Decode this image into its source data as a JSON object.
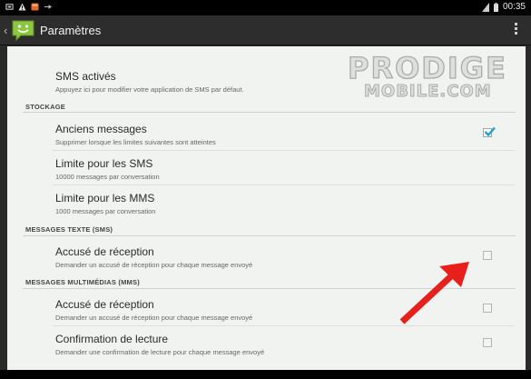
{
  "status_bar": {
    "time": "00:35",
    "icons": [
      "screenshot-icon",
      "warning-icon",
      "app-notification-icon",
      "usb-icon",
      "signal-icon",
      "battery-icon"
    ]
  },
  "action_bar": {
    "title": "Paramètres",
    "app_icon": "messaging-app-icon",
    "overflow_icon": "overflow-menu-icon"
  },
  "watermark": {
    "line1": "PRODIGE",
    "line2": "MOBILE.COM"
  },
  "settings": {
    "sms_enabled": {
      "title": "SMS activés",
      "summary": "Appuyez ici pour modifier votre application de SMS par défaut."
    },
    "storage": {
      "header": "STOCKAGE",
      "old_messages": {
        "title": "Anciens messages",
        "summary": "Supprimer lorsque les limites suivantes sont atteintes",
        "checked": true
      },
      "sms_limit": {
        "title": "Limite pour les SMS",
        "summary": "10000 messages par conversation"
      },
      "mms_limit": {
        "title": "Limite pour les MMS",
        "summary": "1000 messages par conversation"
      }
    },
    "sms_section": {
      "header": "MESSAGES TEXTE (SMS)",
      "delivery_report": {
        "title": "Accusé de réception",
        "summary": "Demander un accusé de réception pour chaque message envoyé",
        "checked": false
      }
    },
    "mms_section": {
      "header": "MESSAGES MULTIMÉDIAS (MMS)",
      "delivery_report": {
        "title": "Accusé de réception",
        "summary": "Demander un accusé de réception pour chaque message envoyé",
        "checked": false
      },
      "read_report": {
        "title": "Confirmation de lecture",
        "summary": "Demander une confirmation de lecture pour chaque message envoyé",
        "checked": false
      }
    }
  },
  "colors": {
    "accent": "#33b5e5",
    "arrow": "#e8201c",
    "app_icon": "#8dc63f"
  }
}
